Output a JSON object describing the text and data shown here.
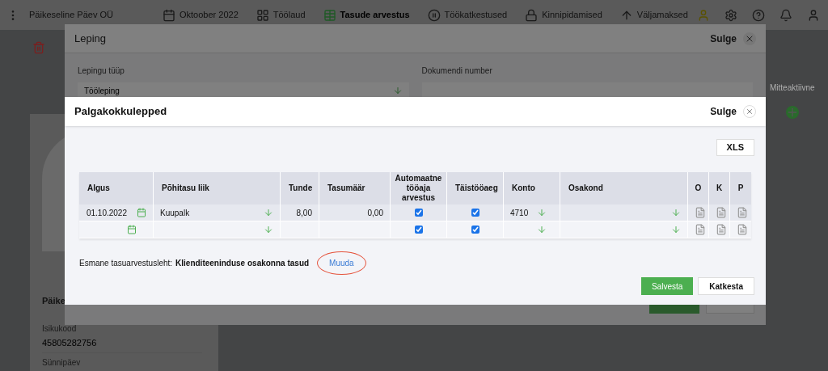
{
  "top_nav": {
    "company": "Päikeseline Päev OÜ",
    "items": [
      {
        "label": "Oktoober 2022",
        "selected": false
      },
      {
        "label": "Töölaud",
        "selected": false
      },
      {
        "label": "Tasude arvestus",
        "selected": true
      },
      {
        "label": "Töökatkestused",
        "selected": false
      },
      {
        "label": "Kinnipidamised",
        "selected": false
      },
      {
        "label": "Väljamaksed",
        "selected": false
      }
    ]
  },
  "background": {
    "person_name": "Päike",
    "fields": [
      {
        "label": "Isikukood",
        "value": "45805282756"
      },
      {
        "label": "Sünnipäev"
      }
    ],
    "status": "Mitteaktiivne"
  },
  "contract_modal": {
    "title": "Leping",
    "close": "Sulge",
    "fields": [
      {
        "label": "Lepingu tüüp",
        "kind": "select",
        "value": "Tööleping"
      },
      {
        "label": "Dokumendi number",
        "kind": "text"
      }
    ]
  },
  "salary_modal": {
    "title": "Palgakokkulepped",
    "close": "Sulge",
    "export": "XLS",
    "table": {
      "columns": [
        "Algus",
        "Põhitasu liik",
        "Tunde",
        "Tasumäär",
        "Automaatne tööaja arvestus",
        "Täistööaeg",
        "Konto",
        "Osakond",
        "O",
        "K",
        "P"
      ],
      "rows": [
        {
          "start": "01.10.2022",
          "type": "Kuupalk",
          "hours": "8,00",
          "rate": "0,00",
          "auto_time": true,
          "full_time": true,
          "account": "4710"
        },
        {
          "auto_time": true,
          "full_time": true
        }
      ]
    },
    "primary_sheet": {
      "label": "Esmane tasuarvestusleht:",
      "value": "Klienditeeninduse osakonna tasud",
      "link": "Muuda"
    },
    "buttons": [
      {
        "label": "Salvesta",
        "kind": "primary"
      },
      {
        "label": "Katkesta",
        "kind": "secondary"
      }
    ]
  }
}
